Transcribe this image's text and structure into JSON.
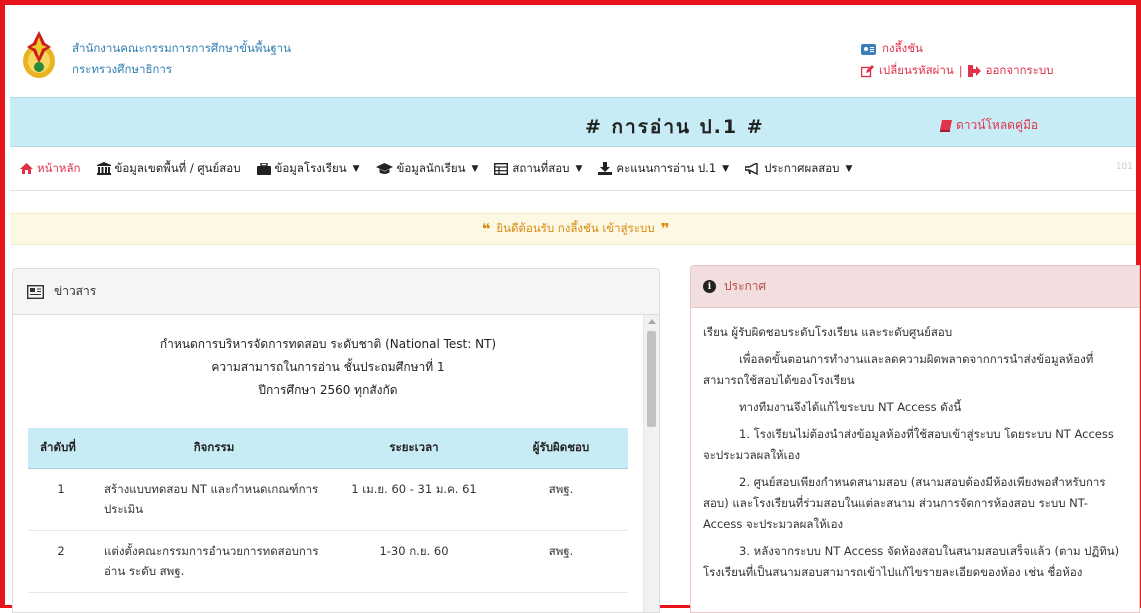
{
  "header": {
    "org_line1": "สำนักงานคณะกรรมการการศึกษาขั้นพื้นฐาน",
    "org_line2": "กระทรวงศึกษาธิการ",
    "user_name": "กงลึ้งชัน",
    "change_password": "เปลี่ยนรหัสผ่าน",
    "separator": "|",
    "logout": "ออกจากระบบ"
  },
  "titlebar": {
    "title": "# การอ่าน ป.1 #",
    "download_manual": "ดาวน์โหลดคู่มือ"
  },
  "nav": {
    "items": [
      {
        "label": "หน้าหลัก",
        "icon": "home-icon",
        "dropdown": false
      },
      {
        "label": "ข้อมูลเขตพื้นที่ / ศูนย์สอบ",
        "icon": "bank-icon",
        "dropdown": false
      },
      {
        "label": "ข้อมูลโรงเรียน",
        "icon": "briefcase-icon",
        "dropdown": true
      },
      {
        "label": "ข้อมูลนักเรียน",
        "icon": "graduation-cap-icon",
        "dropdown": true
      },
      {
        "label": "สถานที่สอบ",
        "icon": "table-icon",
        "dropdown": true
      },
      {
        "label": "คะแนนการอ่าน ป.1",
        "icon": "download-icon",
        "dropdown": true
      },
      {
        "label": "ประกาศผลสอบ",
        "icon": "megaphone-icon",
        "dropdown": true
      }
    ],
    "extra": "101"
  },
  "welcome": {
    "open_quote": "❝",
    "text": "ยินดีต้อนรับ กงลึ้งชัน เข้าสู่ระบบ",
    "close_quote": "❞"
  },
  "news": {
    "heading": "ข่าวสาร",
    "announcement_line1": "กำหนดการบริหารจัดการทดสอบ ระดับชาติ (National Test: NT)",
    "announcement_line2": "ความสามารถในการอ่าน ชั้นประถมศึกษาที่ 1",
    "announcement_line3": "ปีการศึกษา 2560 ทุกสังกัด",
    "table": {
      "headers": [
        "ลำดับที่",
        "กิจกรรม",
        "ระยะเวลา",
        "ผู้รับผิดชอบ"
      ],
      "rows": [
        {
          "no": "1",
          "activity": "สร้างแบบทดสอบ NT และกำหนดเกณฑ์การประเมิน",
          "period": "1 เม.ย. 60 - 31 ม.ค. 61",
          "responsible": "สพฐ."
        },
        {
          "no": "2",
          "activity": "แต่งตั้งคณะกรรมการอำนวยการทดสอบการอ่าน ระดับ สพฐ.",
          "period": "1-30 ก.ย. 60",
          "responsible": "สพฐ."
        }
      ]
    }
  },
  "announce": {
    "heading": "ประกาศ",
    "p1": "เรียน ผู้รับผิดชอบระดับโรงเรียน และระดับศูนย์สอบ",
    "p2": "เพื่อลดขั้นตอนการทำงานและลดความผิดพลาดจากการนำส่งข้อมูลห้องที่สามารถใช้สอบได้ของโรงเรียน",
    "p3": "ทางทีมงานจึงได้แก้ไขระบบ NT Access ดังนี้",
    "p4": "1. โรงเรียนไม่ต้องนำส่งข้อมูลห้องที่ใช้สอบเข้าสู่ระบบ โดยระบบ NT Access จะประมวลผลให้เอง",
    "p5": "2. ศูนย์สอบเพียงกำหนดสนามสอบ (สนามสอบต้องมีห้องเพียงพอสำหรับการสอบ) และโรงเรียนที่ร่วมสอบในแต่ละสนาม ส่วนการจัดการห้องสอบ ระบบ NT-Access จะประมวลผลให้เอง",
    "p6": "3. หลังจากระบบ NT Access จัดห้องสอบในสนามสอบเสร็จแล้ว (ตาม ปฏิทิน) โรงเรียนที่เป็นสนามสอบสามารถเข้าไปแก้ไขรายละเอียดของห้อง เช่น ชื่อห้อง"
  },
  "colors": {
    "frame_border": "#e8141c",
    "title_band": "#c8ecf5",
    "accent_red": "#e0324b",
    "welcome_bg": "#fcf8e3",
    "announce_head": "#f2dede"
  }
}
